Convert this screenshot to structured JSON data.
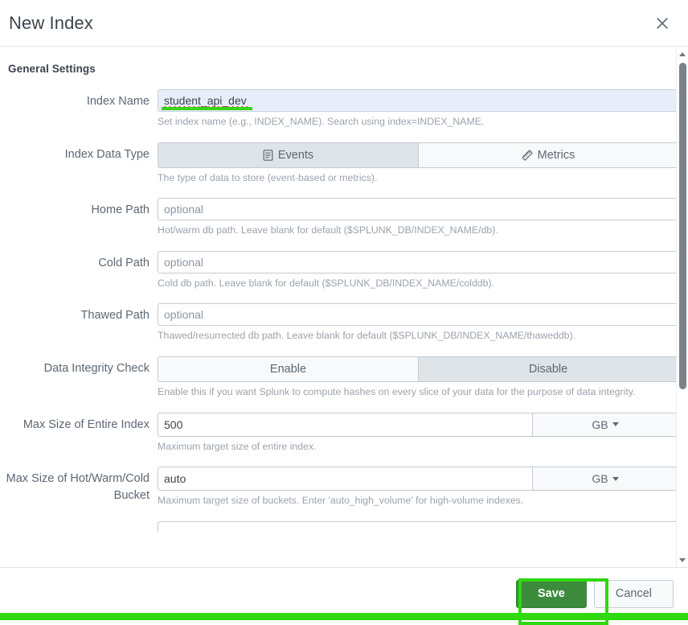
{
  "dialog": {
    "title": "New Index",
    "close_icon": "close-icon"
  },
  "section": {
    "heading": "General Settings"
  },
  "fields": {
    "index_name": {
      "label": "Index Name",
      "value": "student_api_dev",
      "help": "Set index name (e.g., INDEX_NAME). Search using index=INDEX_NAME."
    },
    "index_data_type": {
      "label": "Index Data Type",
      "help": "The type of data to store (event-based or metrics).",
      "options": [
        {
          "label": "Events",
          "icon": "events-icon",
          "selected": true
        },
        {
          "label": "Metrics",
          "icon": "metrics-ruler-icon",
          "selected": false
        }
      ]
    },
    "home_path": {
      "label": "Home Path",
      "value": "",
      "placeholder": "optional",
      "help": "Hot/warm db path. Leave blank for default ($SPLUNK_DB/INDEX_NAME/db)."
    },
    "cold_path": {
      "label": "Cold Path",
      "value": "",
      "placeholder": "optional",
      "help": "Cold db path. Leave blank for default ($SPLUNK_DB/INDEX_NAME/colddb)."
    },
    "thawed_path": {
      "label": "Thawed Path",
      "value": "",
      "placeholder": "optional",
      "help": "Thawed/resurrected db path. Leave blank for default ($SPLUNK_DB/INDEX_NAME/thaweddb)."
    },
    "data_integrity_check": {
      "label": "Data Integrity Check",
      "help": "Enable this if you want Splunk to compute hashes on every slice of your data for the purpose of data integrity.",
      "options": [
        {
          "label": "Enable",
          "selected": false
        },
        {
          "label": "Disable",
          "selected": true
        }
      ]
    },
    "max_size_entire_index": {
      "label": "Max Size of Entire Index",
      "value": "500",
      "unit": "GB",
      "help": "Maximum target size of entire index."
    },
    "max_size_bucket": {
      "label": "Max Size of Hot/Warm/Cold Bucket",
      "value": "auto",
      "unit": "GB",
      "help": "Maximum target size of buckets. Enter 'auto_high_volume' for high-volume indexes."
    }
  },
  "footer": {
    "save_label": "Save",
    "cancel_label": "Cancel"
  },
  "scrollbar": {
    "up_icon": "scroll-up-arrow-icon",
    "down_icon": "scroll-down-arrow-icon"
  },
  "annotations": {
    "accent_green": "#2fd80f",
    "save_green": "#3c8b3c"
  }
}
